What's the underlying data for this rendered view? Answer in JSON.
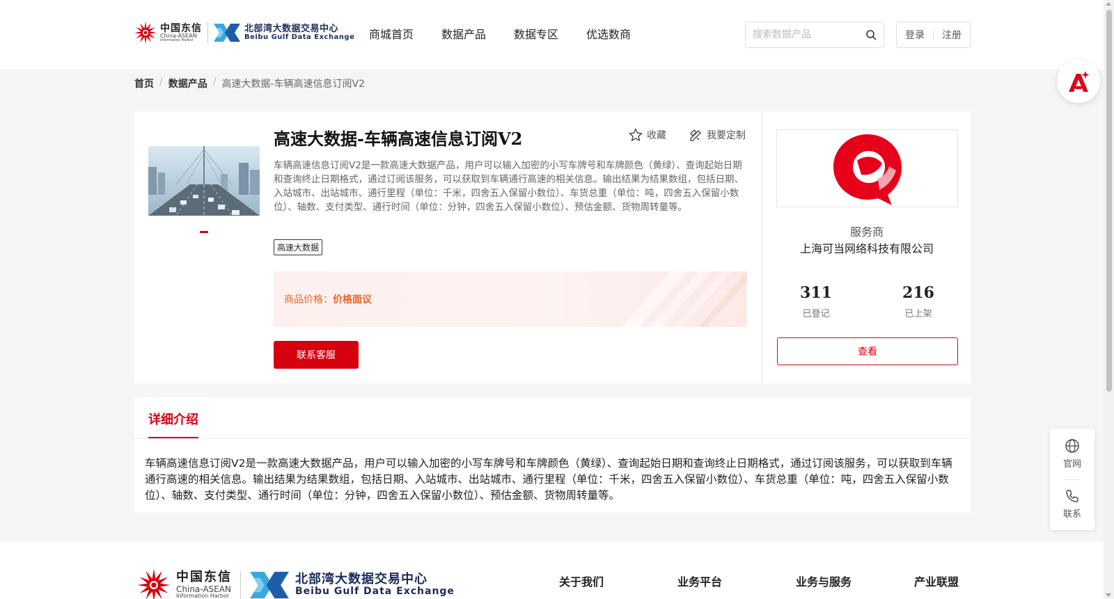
{
  "header": {
    "logo_ct_cn": "中国东信",
    "logo_ct_en": "China-ASEAN",
    "logo_ct_en2": "Information Harbor",
    "logo_bg_cn": "北部湾大数据交易中心",
    "logo_bg_en": "Beibu Gulf Data Exchange",
    "nav": [
      "商城首页",
      "数据产品",
      "数据专区",
      "优选数商"
    ],
    "search_placeholder": "搜索数据产品",
    "login": "登录",
    "register": "注册"
  },
  "breadcrumb": {
    "home": "首页",
    "category": "数据产品",
    "current": "高速大数据-车辆高速信息订阅V2"
  },
  "product": {
    "title": "高速大数据-车辆高速信息订阅V2",
    "favorite": "收藏",
    "customize": "我要定制",
    "description": "车辆高速信息订阅V2是一款高速大数据产品，用户可以输入加密的小写车牌号和车牌颜色（黄绿）、查询起始日期和查询终止日期格式，通过订阅该服务，可以获取到车辆通行高速的相关信息。输出结果为结果数组，包括日期、入站城市、出站城市、通行里程（单位：千米，四舍五入保留小数位）、车货总重（单位：吨，四舍五入保留小数位）、轴数、支付类型、通行时间（单位：分钟，四舍五入保留小数位）、预估金额、货物周转量等。",
    "tag": "高速大数据",
    "price_label": "商品价格：",
    "price_value": "价格面议",
    "contact_button": "联系客服"
  },
  "provider": {
    "role": "服务商",
    "name": "上海可当网络科技有限公司",
    "registered_count": "311",
    "registered_label": "已登记",
    "listed_count": "216",
    "listed_label": "已上架",
    "view_button": "查看"
  },
  "detail": {
    "tab": "详细介绍",
    "text": "车辆高速信息订阅V2是一款高速大数据产品，用户可以输入加密的小写车牌号和车牌颜色（黄绿）、查询起始日期和查询终止日期格式，通过订阅该服务，可以获取到车辆通行高速的相关信息。输出结果为结果数组，包括日期、入站城市、出站城市、通行里程（单位：千米，四舍五入保留小数位）、车货总重（单位：吨，四舍五入保留小数位）、轴数、支付类型、通行时间（单位：分钟，四舍五入保留小数位）、预估金额、货物周转量等。"
  },
  "sidebar": {
    "official": "官网",
    "contact": "联系"
  },
  "footer": {
    "links": [
      "关于我们",
      "业务平台",
      "业务与服务",
      "产业联盟"
    ]
  },
  "colors": {
    "brand_red": "#d7000f",
    "price_orange": "#e8662d",
    "navy": "#1a2a5e"
  }
}
